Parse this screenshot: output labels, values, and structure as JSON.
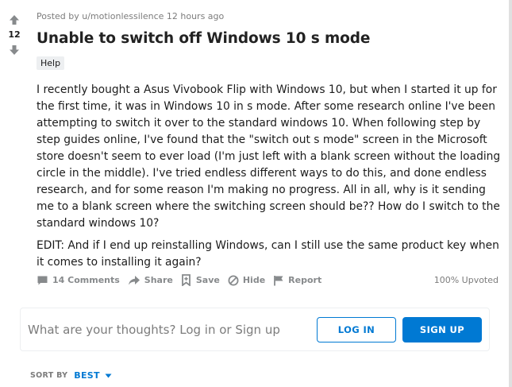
{
  "votes": {
    "count": "12"
  },
  "post": {
    "meta": "Posted by u/motionlessilence 12 hours ago",
    "title": "Unable to switch off Windows 10 s mode",
    "flair": "Help",
    "paragraphs": [
      "I recently bought a Asus Vivobook Flip with Windows 10, but when I started it up for the first time, it was in Windows 10 in s mode. After some research online I've been attempting to switch it over to the standard windows 10. When following step by step guides online, I've found that the \"switch out s mode\" screen in the Microsoft store doesn't seem to ever load (I'm just left with a blank screen without the loading circle in the middle). I've tried endless different ways to do this, and done endless research, and for some reason I'm making no progress. All in all, why is it sending me to a blank screen where the switching screen should be?? How do I switch to the standard windows 10?",
      "EDIT: And if I end up reinstalling Windows, can I still use the same product key when it comes to installing it again?"
    ]
  },
  "actions": {
    "comments": "14 Comments",
    "share": "Share",
    "save": "Save",
    "hide": "Hide",
    "report": "Report",
    "upvoted": "100% Upvoted"
  },
  "comment_box": {
    "prompt": "What are your thoughts? Log in or Sign up",
    "login_label": "LOG IN",
    "signup_label": "SIGN UP"
  },
  "sort": {
    "label": "SORT BY",
    "value": "BEST"
  },
  "colors": {
    "accent": "#0079d3",
    "muted": "#878a8c",
    "flair_bg": "#edeff1"
  }
}
